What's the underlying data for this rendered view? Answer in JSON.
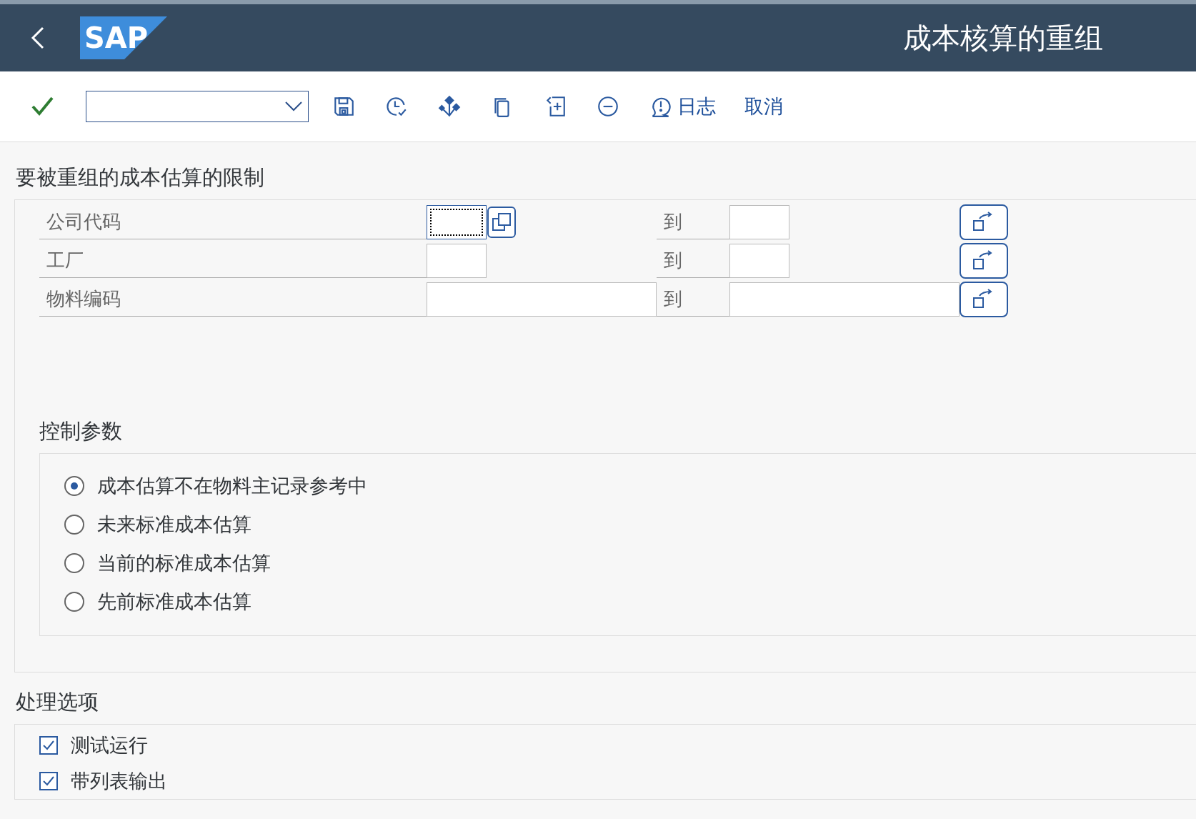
{
  "header": {
    "logo": "SAP",
    "title": "成本核算的重组"
  },
  "toolbar": {
    "buttons": [
      {
        "kind": "save"
      },
      {
        "kind": "history"
      },
      {
        "kind": "network"
      },
      {
        "kind": "copy"
      },
      {
        "kind": "insert"
      },
      {
        "kind": "remove"
      },
      {
        "kind": "log",
        "label": "日志"
      },
      {
        "kind": "text",
        "label": "取消"
      }
    ]
  },
  "restrictions": {
    "title": "要被重组的成本估算的限制",
    "rows": [
      {
        "label": "公司代码",
        "kind": "short",
        "focused": true,
        "value_help": true,
        "to_label": "到"
      },
      {
        "label": "工厂",
        "kind": "short",
        "focused": false,
        "value_help": false,
        "to_label": "到"
      },
      {
        "label": "物料编码",
        "kind": "long",
        "focused": false,
        "value_help": false,
        "to_label": "到"
      }
    ]
  },
  "control": {
    "title": "控制参数",
    "options": [
      {
        "label": "成本估算不在物料主记录参考中",
        "selected": true
      },
      {
        "label": "未来标准成本估算",
        "selected": false
      },
      {
        "label": "当前的标准成本估算",
        "selected": false
      },
      {
        "label": "先前标准成本估算",
        "selected": false
      }
    ]
  },
  "processing": {
    "title": "处理选项",
    "options": [
      {
        "label": "测试运行",
        "checked": true
      },
      {
        "label": "带列表输出",
        "checked": true
      }
    ]
  }
}
